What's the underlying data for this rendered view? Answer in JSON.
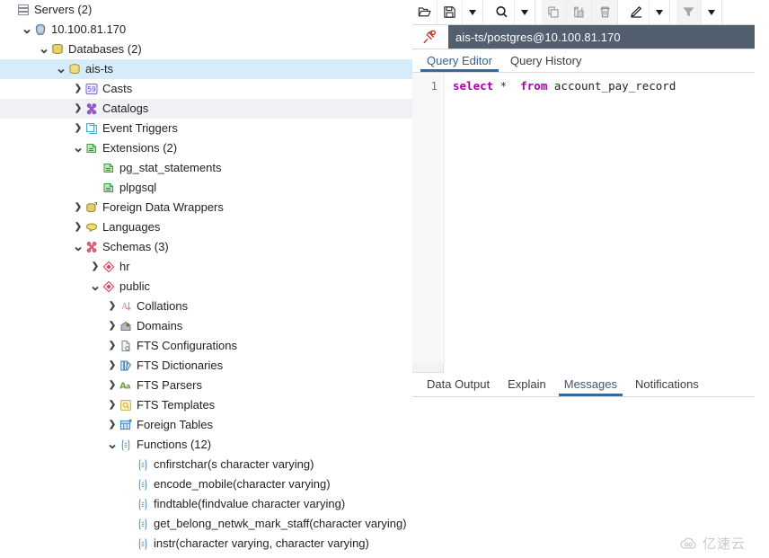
{
  "colors": {
    "selected_row": "#d7ecfa",
    "alt_row": "#f0f1f4",
    "conn_tab_bg": "#515f6e",
    "active_tab_underline": "#336b9b",
    "keyword": "#af00af",
    "watermark": "#9aa3ad"
  },
  "browser": {
    "tree": [
      {
        "label": "Servers (2)",
        "indent": 0,
        "twisty": "",
        "icon": "servers-icon",
        "state": "normal"
      },
      {
        "label": "10.100.81.170",
        "indent": 1,
        "twisty": "v",
        "icon": "postgres-server-icon",
        "state": "normal"
      },
      {
        "label": "Databases (2)",
        "indent": 2,
        "twisty": "v",
        "icon": "databases-icon",
        "state": "normal"
      },
      {
        "label": "ais-ts",
        "indent": 3,
        "twisty": "v",
        "icon": "database-icon",
        "state": "selected"
      },
      {
        "label": "Casts",
        "indent": 4,
        "twisty": ">",
        "icon": "casts-icon",
        "state": "normal"
      },
      {
        "label": "Catalogs",
        "indent": 4,
        "twisty": ">",
        "icon": "catalogs-icon",
        "state": "alt"
      },
      {
        "label": "Event Triggers",
        "indent": 4,
        "twisty": ">",
        "icon": "event-triggers-icon",
        "state": "normal"
      },
      {
        "label": "Extensions (2)",
        "indent": 4,
        "twisty": "v",
        "icon": "extensions-icon",
        "state": "normal"
      },
      {
        "label": "pg_stat_statements",
        "indent": 5,
        "twisty": "",
        "icon": "extension-icon",
        "state": "normal"
      },
      {
        "label": "plpgsql",
        "indent": 5,
        "twisty": "",
        "icon": "extension-icon",
        "state": "normal"
      },
      {
        "label": "Foreign Data Wrappers",
        "indent": 4,
        "twisty": ">",
        "icon": "foreign-data-wrappers-icon",
        "state": "normal"
      },
      {
        "label": "Languages",
        "indent": 4,
        "twisty": ">",
        "icon": "languages-icon",
        "state": "normal"
      },
      {
        "label": "Schemas (3)",
        "indent": 4,
        "twisty": "v",
        "icon": "schemas-icon",
        "state": "normal"
      },
      {
        "label": "hr",
        "indent": 5,
        "twisty": ">",
        "icon": "schema-icon",
        "state": "normal"
      },
      {
        "label": "public",
        "indent": 5,
        "twisty": "v",
        "icon": "schema-icon",
        "state": "normal"
      },
      {
        "label": "Collations",
        "indent": 6,
        "twisty": ">",
        "icon": "collations-icon",
        "state": "normal"
      },
      {
        "label": "Domains",
        "indent": 6,
        "twisty": ">",
        "icon": "domains-icon",
        "state": "normal"
      },
      {
        "label": "FTS Configurations",
        "indent": 6,
        "twisty": ">",
        "icon": "fts-configurations-icon",
        "state": "normal"
      },
      {
        "label": "FTS Dictionaries",
        "indent": 6,
        "twisty": ">",
        "icon": "fts-dictionaries-icon",
        "state": "normal"
      },
      {
        "label": "FTS Parsers",
        "indent": 6,
        "twisty": ">",
        "icon": "fts-parsers-icon",
        "state": "normal"
      },
      {
        "label": "FTS Templates",
        "indent": 6,
        "twisty": ">",
        "icon": "fts-templates-icon",
        "state": "normal"
      },
      {
        "label": "Foreign Tables",
        "indent": 6,
        "twisty": ">",
        "icon": "foreign-tables-icon",
        "state": "normal"
      },
      {
        "label": "Functions (12)",
        "indent": 6,
        "twisty": "v",
        "icon": "functions-icon",
        "state": "normal"
      },
      {
        "label": "cnfirstchar(s character varying)",
        "indent": 7,
        "twisty": "",
        "icon": "function-icon",
        "state": "normal"
      },
      {
        "label": "encode_mobile(character varying)",
        "indent": 7,
        "twisty": "",
        "icon": "function-icon",
        "state": "normal"
      },
      {
        "label": "findtable(findvalue character varying)",
        "indent": 7,
        "twisty": "",
        "icon": "function-icon",
        "state": "normal"
      },
      {
        "label": "get_belong_netwk_mark_staff(character varying)",
        "indent": 7,
        "twisty": "",
        "icon": "function-icon",
        "state": "normal"
      },
      {
        "label": "instr(character varying, character varying)",
        "indent": 7,
        "twisty": "",
        "icon": "function-icon",
        "state": "normal"
      }
    ]
  },
  "query_tool": {
    "toolbar": [
      {
        "name": "open-file-button",
        "icon": "open-folder-icon",
        "enabled": true,
        "kind": "btn"
      },
      {
        "name": "save-file-button",
        "icon": "save-floppy-icon",
        "enabled": true,
        "kind": "btn"
      },
      {
        "name": "save-options-menu",
        "icon": "chevron-down-icon",
        "enabled": true,
        "kind": "caret"
      },
      {
        "name": "find-button",
        "icon": "search-icon",
        "enabled": true,
        "kind": "btn"
      },
      {
        "name": "find-options-menu",
        "icon": "chevron-down-icon",
        "enabled": true,
        "kind": "caret"
      },
      {
        "name": "copy-button",
        "icon": "copy-icon",
        "enabled": false,
        "kind": "btn"
      },
      {
        "name": "paste-button",
        "icon": "paste-icon",
        "enabled": false,
        "kind": "btn"
      },
      {
        "name": "delete-button",
        "icon": "trash-icon",
        "enabled": false,
        "kind": "btn"
      },
      {
        "name": "edit-button",
        "icon": "edit-pencil-icon",
        "enabled": true,
        "kind": "btn"
      },
      {
        "name": "edit-options-menu",
        "icon": "chevron-down-icon",
        "enabled": true,
        "kind": "caret"
      },
      {
        "name": "filter-button",
        "icon": "filter-icon",
        "enabled": false,
        "kind": "btn"
      },
      {
        "name": "filter-options-menu",
        "icon": "chevron-down-icon",
        "enabled": true,
        "kind": "caret"
      }
    ],
    "connection": {
      "pin_icon": "pin-icon",
      "title": "ais-ts/postgres@10.100.81.170"
    },
    "editor_tabs": [
      {
        "label": "Query Editor",
        "active": true
      },
      {
        "label": "Query History",
        "active": false
      }
    ],
    "editor": {
      "line_number": "1",
      "code_tokens": [
        {
          "text": "select",
          "type": "keyword"
        },
        {
          "text": " * ",
          "type": "operator"
        },
        {
          "text": " from",
          "type": "keyword"
        },
        {
          "text": " account_pay_record",
          "type": "identifier"
        }
      ],
      "code_plain": "select *  from account_pay_record"
    },
    "result_tabs": [
      {
        "label": "Data Output",
        "active": false
      },
      {
        "label": "Explain",
        "active": false
      },
      {
        "label": "Messages",
        "active": true
      },
      {
        "label": "Notifications",
        "active": false
      }
    ],
    "result_body_text": ""
  },
  "watermark": {
    "icon": "cloud-logo-icon",
    "text": "亿速云"
  }
}
